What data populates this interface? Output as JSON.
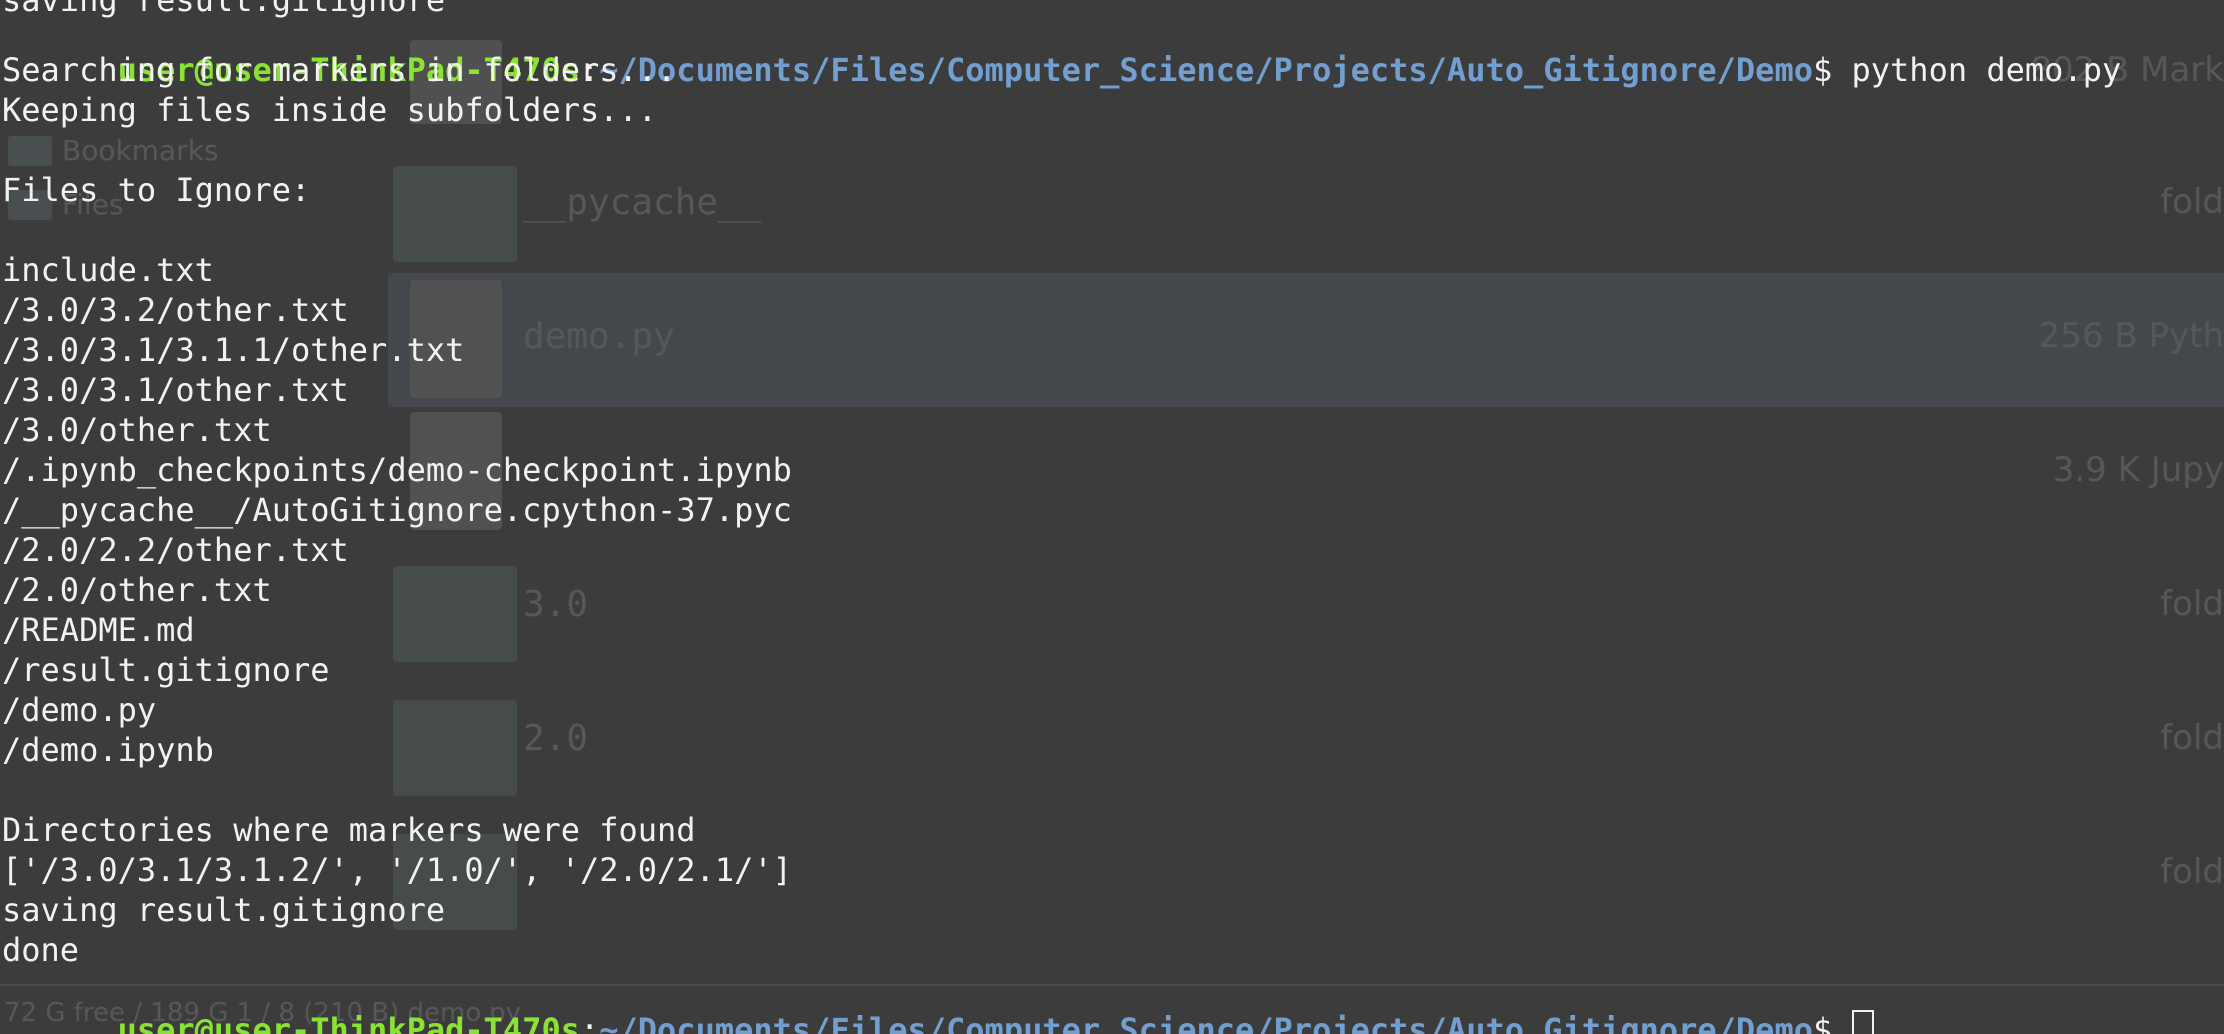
{
  "background_file_manager": {
    "sidebar": [
      "Bookmarks",
      "Files"
    ],
    "rows": [
      {
        "name": "__pycache__",
        "meta": "fold"
      },
      {
        "name": "demo.py",
        "meta": "256 B Pyth"
      },
      {
        "name": "",
        "meta": "3.9 K Jupy"
      },
      {
        "name": "3.0",
        "meta": "fold"
      },
      {
        "name": "2.0",
        "meta": "fold"
      },
      {
        "name": "",
        "meta": "fold"
      }
    ],
    "top_meta": "802 B Mark",
    "status_bar": "72 G free / 189 G   1 / 8 (210 B)   demo.py"
  },
  "terminal": {
    "top_partial_line": "saving result.gitignore",
    "prompt": {
      "user_host": "user@user-ThinkPad-T470s",
      "colon": ":",
      "path": "~/Documents/Files/Computer_Science/Projects/Auto_Gitignore/Demo",
      "dollar": "$ "
    },
    "command": "python demo.py",
    "output": [
      "Searching for markers in folders...",
      "Keeping files inside subfolders...",
      "",
      "Files to Ignore:",
      "",
      "include.txt",
      "/3.0/3.2/other.txt",
      "/3.0/3.1/3.1.1/other.txt",
      "/3.0/3.1/other.txt",
      "/3.0/other.txt",
      "/.ipynb_checkpoints/demo-checkpoint.ipynb",
      "/__pycache__/AutoGitignore.cpython-37.pyc",
      "/2.0/2.2/other.txt",
      "/2.0/other.txt",
      "/README.md",
      "/result.gitignore",
      "/demo.py",
      "/demo.ipynb",
      "",
      "Directories where markers were found",
      "['/3.0/3.1/3.1.2/', '/1.0/', '/2.0/2.1/']",
      "saving result.gitignore",
      "done"
    ]
  }
}
